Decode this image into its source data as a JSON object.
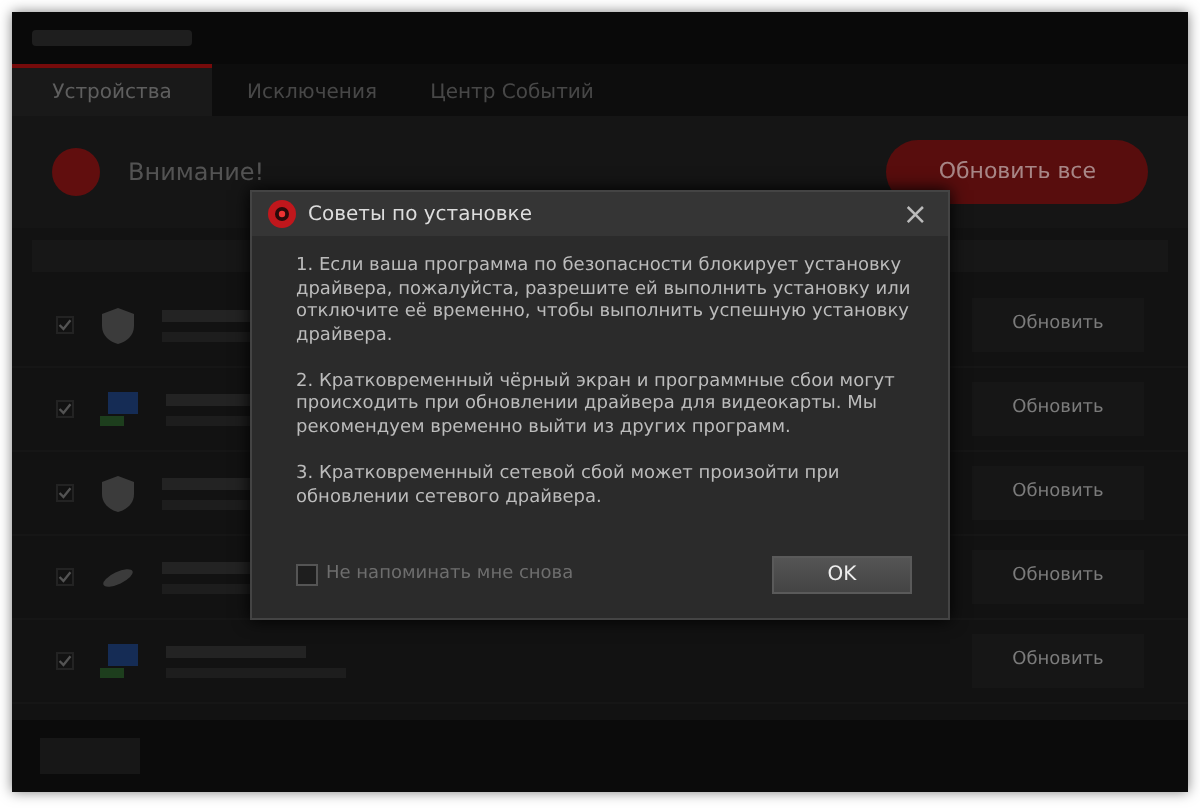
{
  "app": {
    "tabs": [
      {
        "label": "Устройства",
        "selected": true
      },
      {
        "label": "Исключения",
        "selected": false
      },
      {
        "label": "Центр Событий",
        "selected": false
      }
    ],
    "alert": {
      "title": "Внимание!"
    },
    "update_all": "Обновить все",
    "rows": [
      {
        "kind": "shield",
        "checked": true,
        "button": "Обновить"
      },
      {
        "kind": "network",
        "checked": true,
        "button": "Обновить"
      },
      {
        "kind": "shield",
        "checked": true,
        "button": "Обновить"
      },
      {
        "kind": "mouse",
        "checked": true,
        "button": "Обновить"
      },
      {
        "kind": "network",
        "checked": true,
        "button": "Обновить"
      }
    ]
  },
  "dialog": {
    "title": "Советы по установке",
    "close": "×",
    "paragraphs": [
      "1. Если ваша программа по безопасности блокирует установку драйвера, пожалуйста, разрешите ей выполнить установку или отключите её временно, чтобы выполнить успешную установку драйвера.",
      "2. Кратковременный чёрный экран и программные сбои могут происходить при обновлении драйвера для видеокарты. Мы рекомендуем временно выйти из других программ.",
      "3. Кратковременный сетевой сбой может произойти при обновлении сетевого драйвера."
    ],
    "dont_remind": {
      "label": "Не напоминать мне снова",
      "checked": false
    },
    "ok": "OK"
  }
}
